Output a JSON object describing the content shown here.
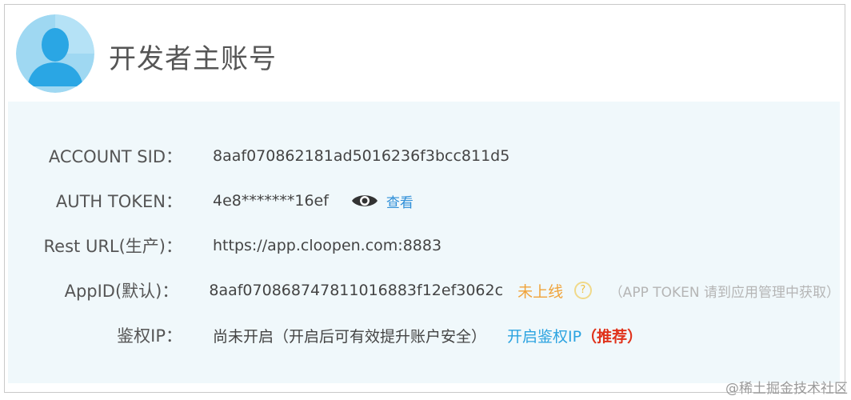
{
  "header": {
    "title": "开发者主账号",
    "avatar_icon": "user-avatar-icon"
  },
  "rows": [
    {
      "label": "ACCOUNT SID：",
      "value": "8aaf070862181ad5016236f3bcc811d5"
    },
    {
      "label": "AUTH TOKEN：",
      "value": "4e8*******16ef",
      "action_label": "查看",
      "action_icon": "eye-icon"
    },
    {
      "label": "Rest URL(生产)：",
      "value": "https://app.cloopen.com:8883"
    },
    {
      "label": "AppID(默认)：",
      "value": "8aaf070868747811016883f12ef3062c",
      "status": "未上线",
      "help_icon": "question-icon",
      "hint": "（APP TOKEN 请到应用管理中获取）"
    },
    {
      "label": "鉴权IP：",
      "value": "尚未开启（开启后可有效提升账户安全）",
      "action_label": "开启鉴权IP",
      "recommend": "（推荐）"
    }
  ],
  "watermark": "@稀土掘金技术社区",
  "colors": {
    "panel_bg": "#f0f8fb",
    "link": "#2f8fd8",
    "status_offline": "#f0a33a",
    "recommend": "#e0321b"
  }
}
